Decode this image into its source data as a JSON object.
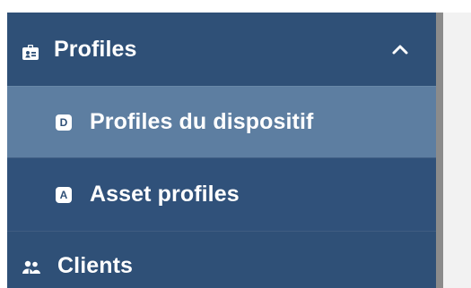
{
  "sidebar": {
    "profiles": {
      "label": "Profiles",
      "icon": "id-card-icon",
      "expanded": true
    },
    "children": [
      {
        "badge": "D",
        "label": "Profiles du dispositif",
        "active": true
      },
      {
        "badge": "A",
        "label": "Asset profiles",
        "active": false
      }
    ],
    "clients": {
      "label": "Clients",
      "icon": "people-icon"
    }
  },
  "colors": {
    "sidebar": "#2f5077",
    "active_item": "#5d7ea1",
    "text": "#ffffff",
    "border": "#8b8b8b"
  }
}
